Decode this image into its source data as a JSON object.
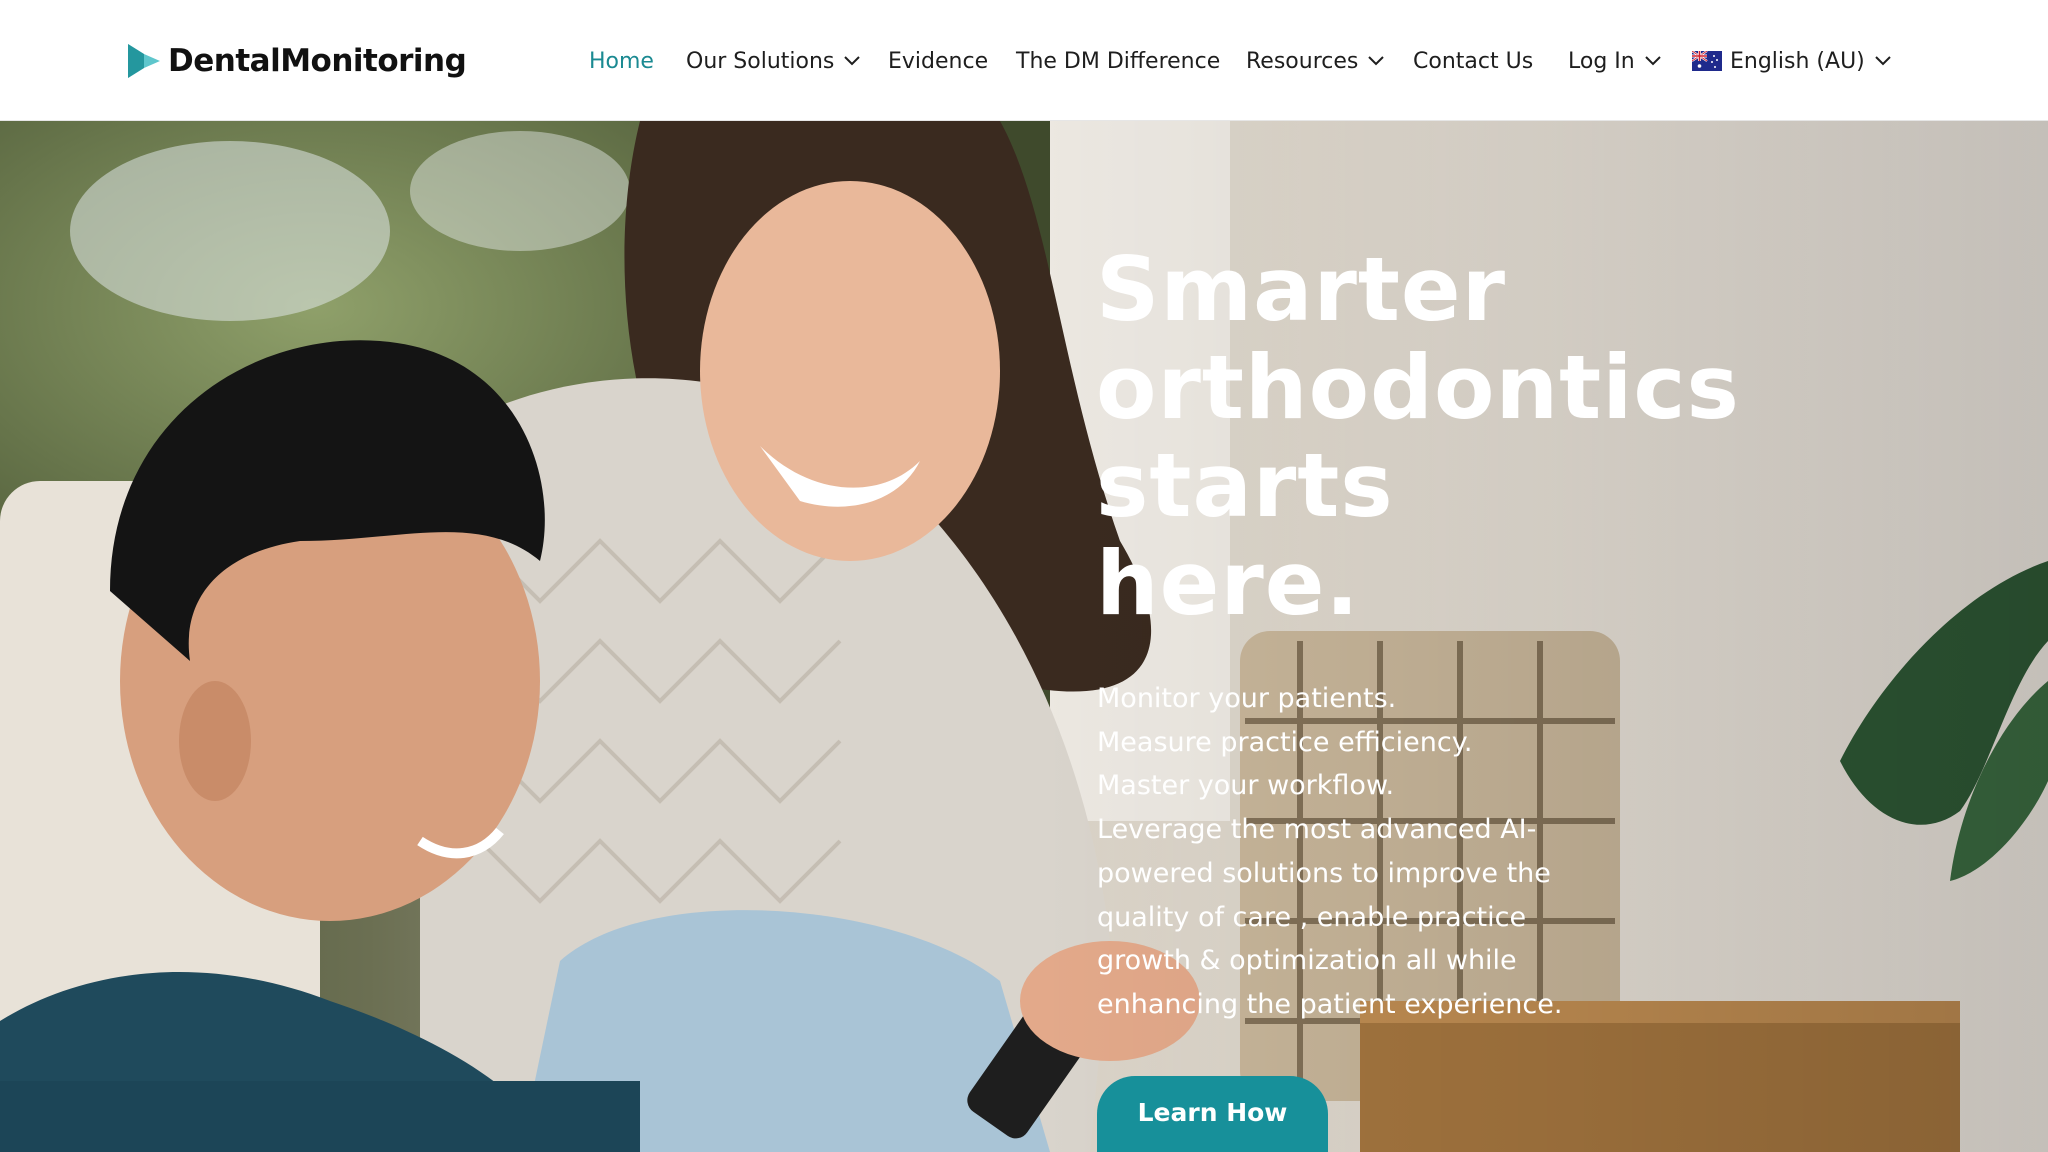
{
  "brand": {
    "name": "DentalMonitoring",
    "accent_color": "#17909a",
    "nav_active_color": "#1b8a92"
  },
  "nav": {
    "items": [
      {
        "label": "Home",
        "active": true,
        "has_dropdown": false
      },
      {
        "label": "Our Solutions",
        "active": false,
        "has_dropdown": true
      },
      {
        "label": "Evidence",
        "active": false,
        "has_dropdown": false
      },
      {
        "label": "The DM Difference",
        "active": false,
        "has_dropdown": false
      },
      {
        "label": "Resources",
        "active": false,
        "has_dropdown": true
      },
      {
        "label": "Contact Us",
        "active": false,
        "has_dropdown": false
      }
    ],
    "login": {
      "label": "Log In",
      "has_dropdown": true
    },
    "language": {
      "label": "English (AU)",
      "flag_icon": "australia-flag-icon",
      "has_dropdown": true
    }
  },
  "hero": {
    "title_lines": [
      "Smarter",
      "orthodontics",
      "starts",
      "here."
    ],
    "copy_lines": [
      "Monitor your patients.",
      "Measure practice efficiency.",
      "Master your workflow.",
      "Leverage the most advanced AI-",
      "powered solutions to improve the",
      "quality of care , enable practice",
      "growth & optimization all while",
      "enhancing the patient experience."
    ],
    "cta_label": "Learn How"
  }
}
